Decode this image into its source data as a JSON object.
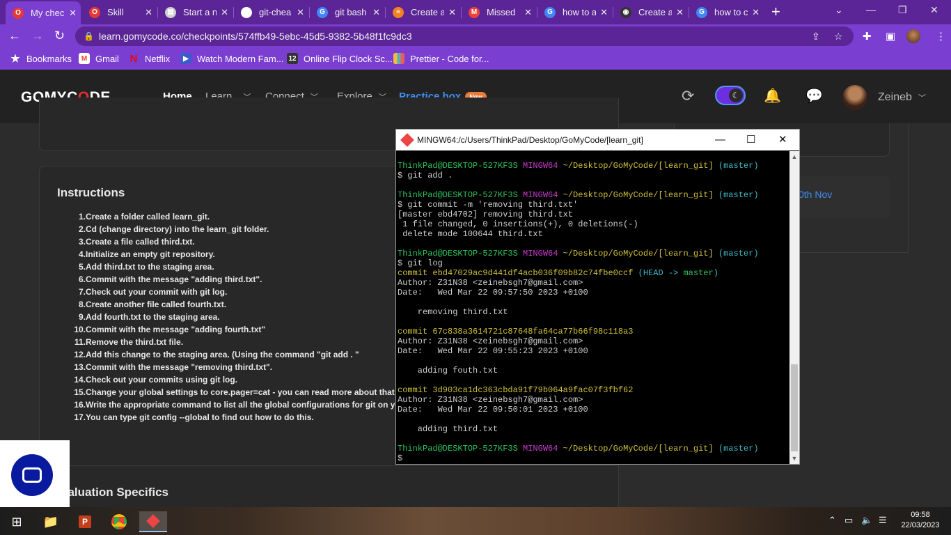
{
  "browser": {
    "tabs": [
      {
        "title": "My chec",
        "icon": "opera-icon",
        "color": "#e53935"
      },
      {
        "title": "Skill",
        "icon": "opera-icon",
        "color": "#e53935"
      },
      {
        "title": "Start a n",
        "icon": "image-icon",
        "color": "#cfcfcf"
      },
      {
        "title": "git-chea",
        "icon": "globe-icon",
        "color": "#ffffff"
      },
      {
        "title": "git bash",
        "icon": "google-icon",
        "color": "#4285f4"
      },
      {
        "title": "Create a",
        "icon": "stackoverflow-icon",
        "color": "#f48024"
      },
      {
        "title": "Missed",
        "icon": "gmail-icon",
        "color": "#ea4335"
      },
      {
        "title": "how to a",
        "icon": "google-icon",
        "color": "#4285f4"
      },
      {
        "title": "Create a",
        "icon": "github-icon",
        "color": "#333333"
      },
      {
        "title": "how to c",
        "icon": "google-icon",
        "color": "#4285f4"
      }
    ],
    "url": "learn.gomycode.co/checkpoints/574ffb49-5ebc-45d5-9382-5b48f1fc9dc3",
    "bookmarks": [
      {
        "label": "Bookmarks",
        "icon": "star-icon"
      },
      {
        "label": "Gmail",
        "icon": "gmail-icon"
      },
      {
        "label": "Netflix",
        "icon": "netflix-icon"
      },
      {
        "label": "Watch Modern Fam...",
        "icon": "tv-icon"
      },
      {
        "label": "Online Flip Clock Sc...",
        "icon": "clock-icon"
      },
      {
        "label": "Prettier - Code for...",
        "icon": "prettier-icon"
      }
    ]
  },
  "site": {
    "logo": {
      "pre": "GOMYC",
      "o": "O",
      "post": "DE"
    },
    "nav": {
      "home": "Home",
      "learn": "Learn",
      "connect": "Connect",
      "explore": "Explore",
      "practice": "Practice box",
      "badge": "New"
    },
    "user_name": "Zeineb",
    "instructions_title": "Instructions",
    "steps": [
      "Create a folder called learn_git.",
      "Cd (change directory) into the learn_git folder.",
      "Create a file called third.txt.",
      "Initialize an empty git repository.",
      "Add third.txt to the staging area.",
      "Commit with the message \"adding third.txt\".",
      "Check out your commit with git log.",
      "Create another file called fourth.txt.",
      "Add fourth.txt to the staging area.",
      "Commit with the message \"adding fourth.txt\"",
      "Remove the third.txt file.",
      "Add this change to the staging area. (Using the command \"git add . \"",
      "Commit with the message \"removing third.txt\".",
      "Check out your commits using git log.",
      "Change your global settings to core.pager=cat - you can read more about that",
      "Write the appropriate command to list all the global configurations for git on yo",
      "You can type git config --global to find out how to do this."
    ],
    "evaluation_title": "valuation Specifics",
    "date_link": "0th Nov"
  },
  "terminal": {
    "title": "MINGW64:/c/Users/ThinkPad/Desktop/GoMyCode/[learn_git]",
    "prompt_user": "ThinkPad@DESKTOP-527KF3S",
    "prompt_env": "MINGW64",
    "prompt_path": "~/Desktop/GoMyCode/[learn_git]",
    "prompt_branch": "(master)",
    "cmd_add": "$ git add .",
    "cmd_commit": "$ git commit -m 'removing third.txt'",
    "commit_out1": "[master ebd4702] removing third.txt",
    "commit_out2": " 1 file changed, 0 insertions(+), 0 deletions(-)",
    "commit_out3": " delete mode 100644 third.txt",
    "cmd_log": "$ git log",
    "log": [
      {
        "hash": "commit ebd47029ac9d441df4acb036f09b82c74fbe0ccf",
        "ref": " (HEAD -> master)",
        "author": "Author: Z31N38 <zeinebsgh7@gmail.com>",
        "date": "Date:   Wed Mar 22 09:57:50 2023 +0100",
        "msg": "    removing third.txt"
      },
      {
        "hash": "commit 67c838a3614721c87648fa64ca77b66f98c118a3",
        "ref": "",
        "author": "Author: Z31N38 <zeinebsgh7@gmail.com>",
        "date": "Date:   Wed Mar 22 09:55:23 2023 +0100",
        "msg": "    adding fouth.txt"
      },
      {
        "hash": "commit 3d903ca1dc363cbda91f79b064a9fac07f3fbf62",
        "ref": "",
        "author": "Author: Z31N38 <zeinebsgh7@gmail.com>",
        "date": "Date:   Wed Mar 22 09:50:01 2023 +0100",
        "msg": "    adding third.txt"
      }
    ],
    "final_prompt": "$"
  },
  "taskbar": {
    "time": "09:58",
    "date": "22/03/2023"
  }
}
